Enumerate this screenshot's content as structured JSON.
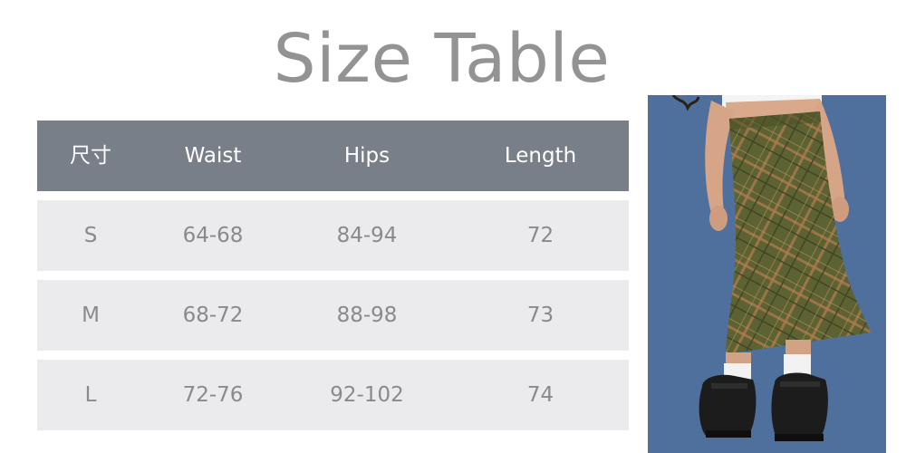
{
  "title": "Size Table",
  "table": {
    "headers": [
      "尺寸",
      "Waist",
      "Hips",
      "Length"
    ],
    "rows": [
      [
        "S",
        "64-68",
        "84-94",
        "72"
      ],
      [
        "M",
        "68-72",
        "88-98",
        "73"
      ],
      [
        "L",
        "72-76",
        "92-102",
        "74"
      ]
    ]
  },
  "colors": {
    "title": "#939393",
    "header_bg": "#787f88",
    "row_bg": "#ebebed",
    "photo_bg": "#4f6f9c",
    "skirt": "#5c6232"
  }
}
